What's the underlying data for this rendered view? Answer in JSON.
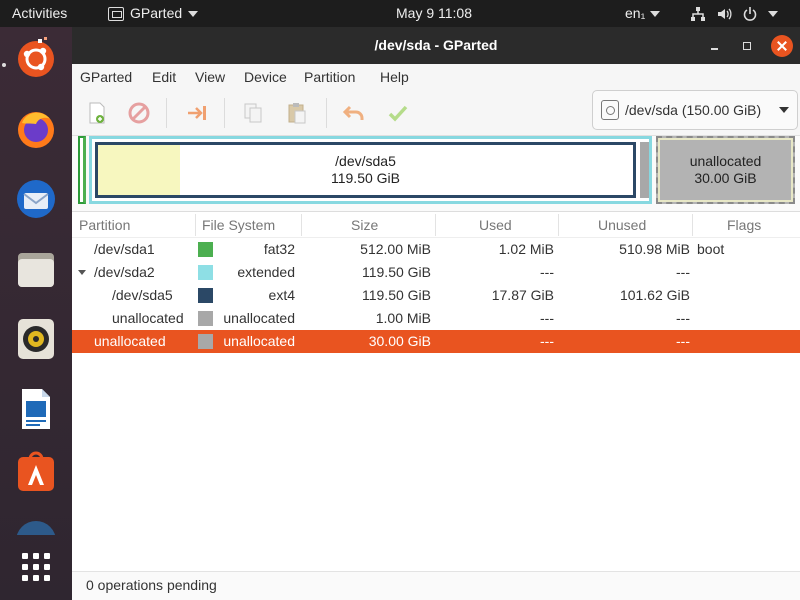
{
  "topbar": {
    "activities": "Activities",
    "app_name": "GParted",
    "clock": "May 9  11:08",
    "language": "en₁"
  },
  "dock": {
    "items": [
      "ubuntu-installer",
      "firefox",
      "thunderbird",
      "files",
      "rhythmbox",
      "libreoffice-writer",
      "ubuntu-software",
      "partial-app",
      "show-applications"
    ]
  },
  "window": {
    "title": "/dev/sda - GParted"
  },
  "menubar": {
    "items": [
      "GParted",
      "Edit",
      "View",
      "Device",
      "Partition",
      "Help"
    ]
  },
  "toolbar": {
    "device_selector": "/dev/sda (150.00 GiB)"
  },
  "graphic": {
    "sda5_label": "/dev/sda5",
    "sda5_size": "119.50 GiB",
    "unallocated_label": "unallocated",
    "unallocated_size": "30.00 GiB"
  },
  "table": {
    "columns": [
      "Partition",
      "File System",
      "Size",
      "Used",
      "Unused",
      "Flags"
    ],
    "rows": [
      {
        "partition": "/dev/sda1",
        "fs": "fat32",
        "size": "512.00 MiB",
        "used": "1.02 MiB",
        "unused": "510.98 MiB",
        "flags": "boot",
        "color": "#4caf50"
      },
      {
        "partition": "/dev/sda2",
        "fs": "extended",
        "size": "119.50 GiB",
        "used": "---",
        "unused": "---",
        "flags": "",
        "color": "#8edfe5"
      },
      {
        "partition": "/dev/sda5",
        "fs": "ext4",
        "size": "119.50 GiB",
        "used": "17.87 GiB",
        "unused": "101.62 GiB",
        "flags": "",
        "color": "#2b4866"
      },
      {
        "partition": "unallocated",
        "fs": "unallocated",
        "size": "1.00 MiB",
        "used": "---",
        "unused": "---",
        "flags": "",
        "color": "#a8a8a8"
      },
      {
        "partition": "unallocated",
        "fs": "unallocated",
        "size": "30.00 GiB",
        "used": "---",
        "unused": "---",
        "flags": "",
        "color": "#a8a8a8"
      }
    ]
  },
  "status": {
    "text": "0 operations pending"
  },
  "colors": {
    "accent": "#e95420",
    "fat32": "#4caf50",
    "extended": "#8edfe5",
    "ext4": "#2b4866",
    "unallocated": "#a8a8a8"
  }
}
